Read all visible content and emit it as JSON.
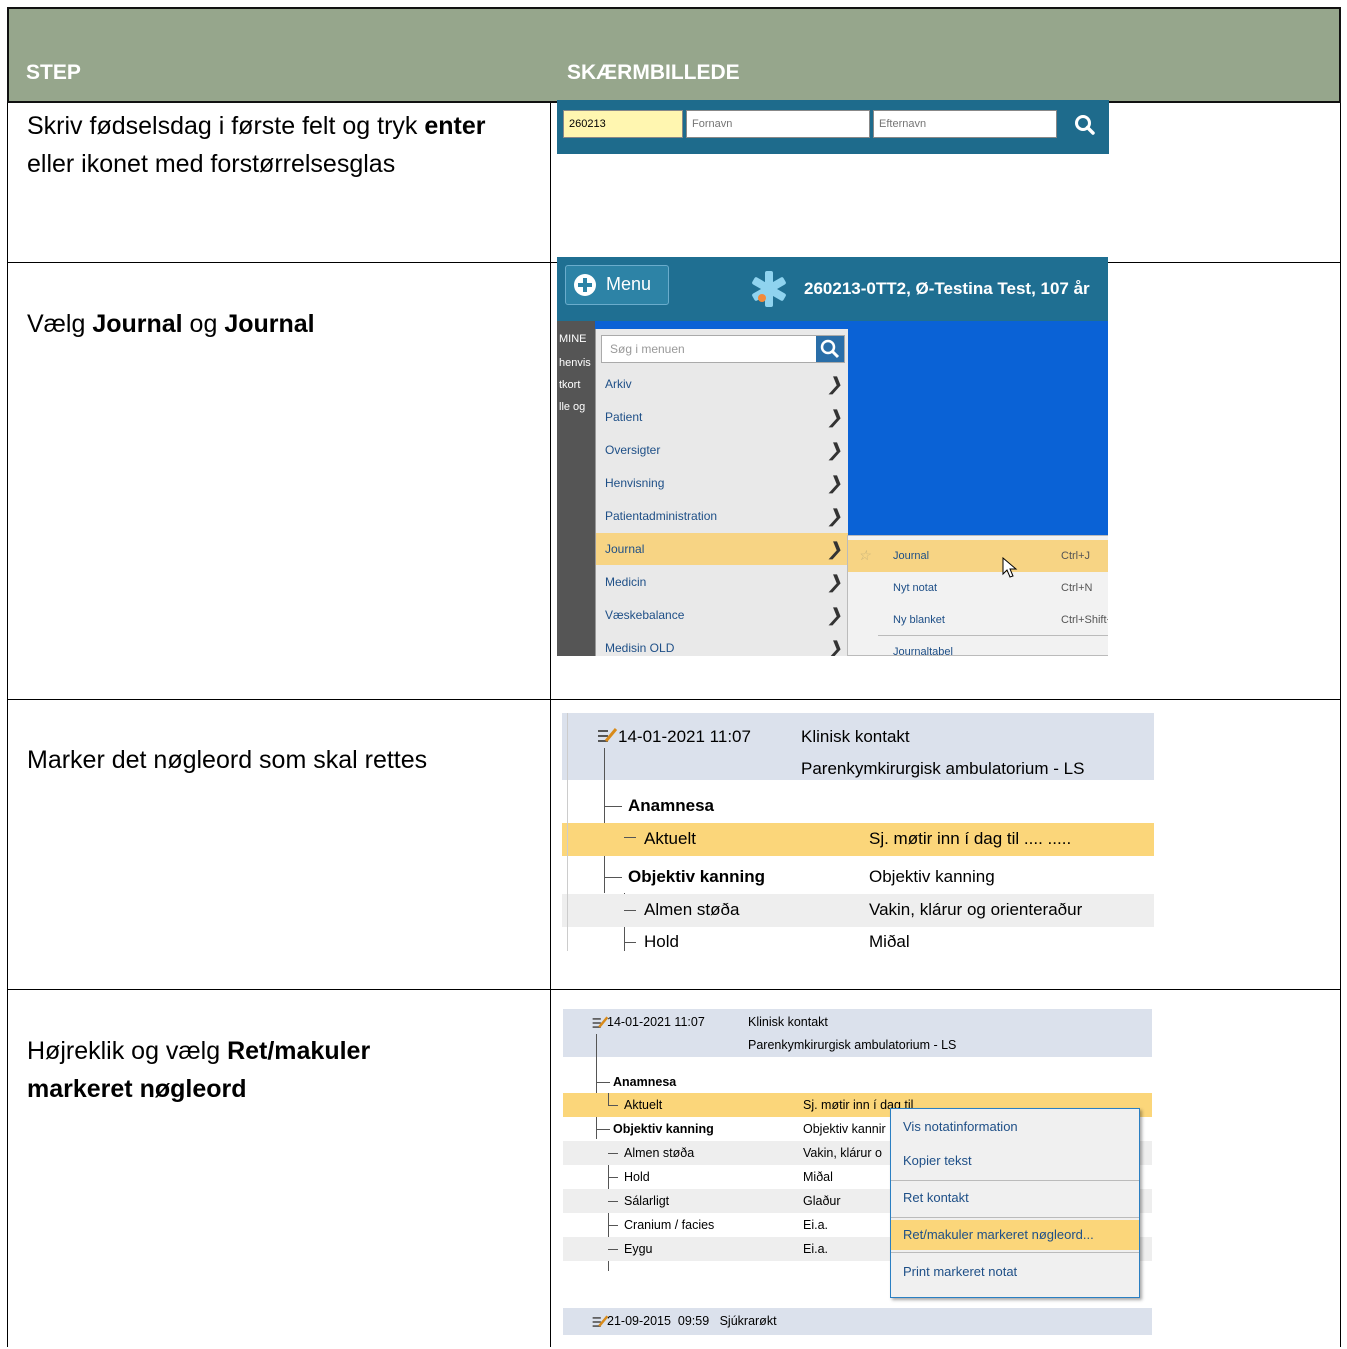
{
  "header": {
    "col1": "STEP",
    "col2": "SKÆRMBILLEDE"
  },
  "colors": {
    "header_bg": "#96a68c",
    "highlight": "#fbd67a",
    "app_blue": "#0a62d6"
  },
  "steps": [
    {
      "pre": "Skriv fødselsdag i første felt og tryk ",
      "bold": "enter",
      "post": " eller ikonet med forstørrelsesglas"
    },
    {
      "t1": "Vælg ",
      "b1": "Journal",
      "t2": " og ",
      "b2": "Journal"
    },
    {
      "text": "Marker det nøgleord som skal rettes"
    },
    {
      "t1": "Højreklik og vælg ",
      "b1": "Ret/makuler markeret nøgleord"
    }
  ],
  "screen1": {
    "birthdate_value": "260213",
    "first_name_placeholder": "Fornavn",
    "last_name_placeholder": "Efternavn",
    "search_icon": "search-icon"
  },
  "screen2": {
    "menu_label": "Menu",
    "patient_header": "260213-0TT2, Ø-Testina Test, 107 år",
    "left_strip": [
      "MINE",
      "henvis",
      "tkort",
      "lle og"
    ],
    "search_placeholder": "Søg i menuen",
    "menu_items": [
      "Arkiv",
      "Patient",
      "Oversigter",
      "Henvisning",
      "Patientadministration",
      "Journal",
      "Medicin",
      "Væskebalance",
      "Medisin OLD"
    ],
    "submenu": [
      {
        "name": "Journal",
        "shortcut": "Ctrl+J"
      },
      {
        "name": "Nyt notat",
        "shortcut": "Ctrl+N"
      },
      {
        "name": "Ny blanket",
        "shortcut": "Ctrl+Shift+F"
      },
      {
        "name": "Journaltabel",
        "shortcut": ""
      }
    ]
  },
  "screen3": {
    "datetime": "14-01-2021  11:07",
    "contact_type": "Klinisk kontakt",
    "department": "Parenkymkirurgisk ambulatorium - LS",
    "rows": [
      {
        "label": "Anamnesa",
        "value": ""
      },
      {
        "label": "Aktuelt",
        "value": "Sj. møtir inn í dag til .... ....."
      },
      {
        "label": "Objektiv kanning",
        "value": "Objektiv kanning"
      },
      {
        "label": "Almen støða",
        "value": "Vakin, klárur og orienteraður"
      },
      {
        "label": "Hold",
        "value": "Miðal"
      }
    ]
  },
  "screen4": {
    "datetime": "14-01-2021  11:07",
    "contact_type": "Klinisk kontakt",
    "department": "Parenkymkirurgisk ambulatorium - LS",
    "rows": [
      {
        "label": "Anamnesa",
        "value": ""
      },
      {
        "label": "Aktuelt",
        "value": "Sj. møtir inn í dag til"
      },
      {
        "label": "Objektiv kanning",
        "value": "Objektiv kannir"
      },
      {
        "label": "Almen støða",
        "value": "Vakin, klárur o"
      },
      {
        "label": "Hold",
        "value": "Miðal"
      },
      {
        "label": "Sálarligt",
        "value": "Glaður"
      },
      {
        "label": "Cranium / facies",
        "value": "Ei.a."
      },
      {
        "label": "Eygu",
        "value": "Ei.a."
      }
    ],
    "footer": "21-09-2015  09:59   Sjúkrarøkt",
    "context_menu": [
      "Vis notatinformation",
      "Kopier tekst",
      "Ret kontakt",
      "Ret/makuler markeret nøgleord...",
      "Print markeret notat"
    ]
  }
}
